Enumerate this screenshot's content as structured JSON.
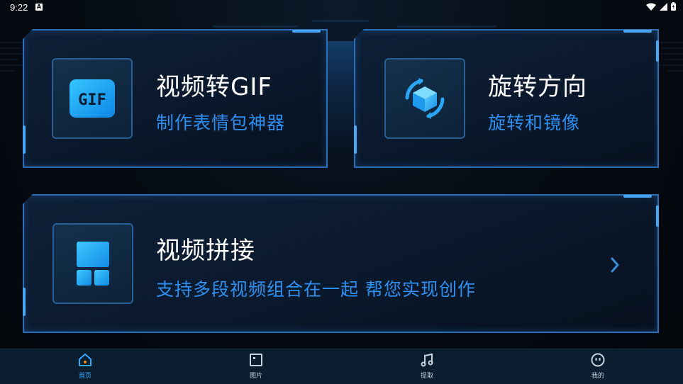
{
  "status_bar": {
    "time": "9:22",
    "badge": "A"
  },
  "cards": {
    "gif": {
      "title": "视频转GIF",
      "subtitle": "制作表情包神器",
      "icon_text": "GIF"
    },
    "rotate": {
      "title": "旋转方向",
      "subtitle": "旋转和镜像"
    },
    "merge": {
      "title": "视频拼接",
      "subtitle": "支持多段视频组合在一起 帮您实现创作"
    }
  },
  "bottom_nav": {
    "items": [
      {
        "label": "首页",
        "icon": "home-icon",
        "active": true
      },
      {
        "label": "图片",
        "icon": "image-icon",
        "active": false
      },
      {
        "label": "提取",
        "icon": "music-note-icon",
        "active": false
      },
      {
        "label": "我的",
        "icon": "profile-icon",
        "active": false
      }
    ]
  },
  "colors": {
    "accent": "#33a8ff",
    "subtitle": "#2f8ff0",
    "card_border": "#2a6fb8",
    "nav_bg": "#0a1e30"
  }
}
